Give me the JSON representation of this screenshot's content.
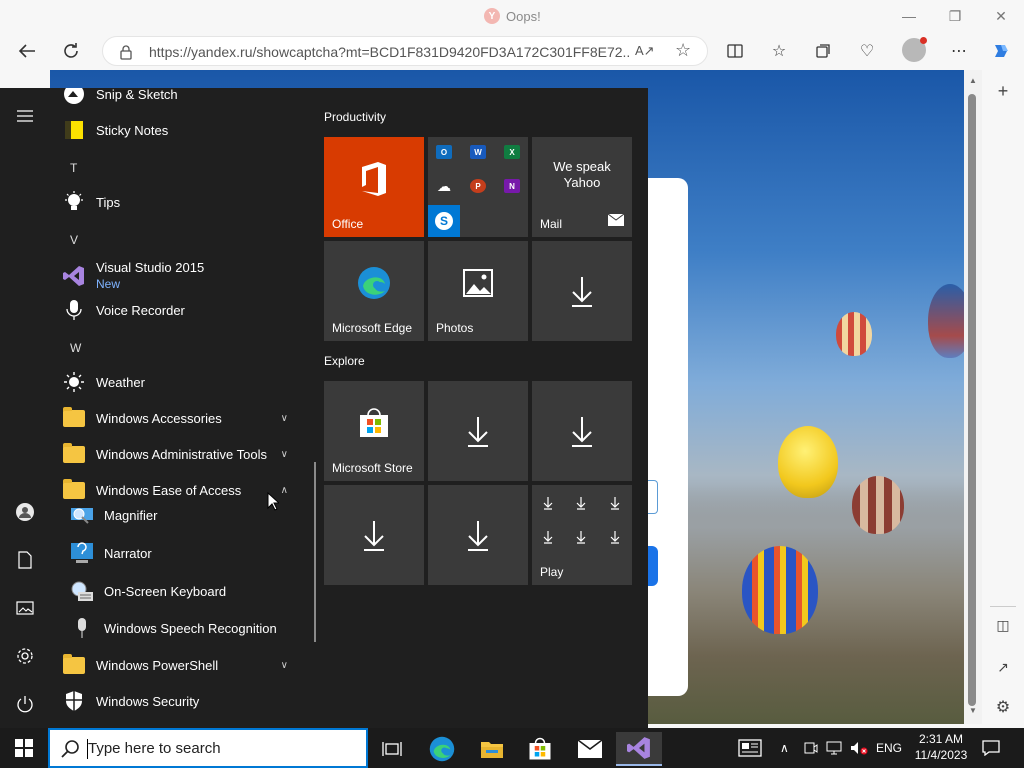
{
  "browser": {
    "tab_title": "Oops!",
    "tab_icon_letter": "Y",
    "url": "https://yandex.ru/showcaptcha?mt=BCD1F831D9420FD3A172C301FF8E72..."
  },
  "start_menu": {
    "apps": [
      {
        "label": "Snip & Sketch",
        "icon": "snip-sketch-icon"
      },
      {
        "label": "Sticky Notes",
        "icon": "sticky-notes-icon"
      },
      {
        "letter": "T"
      },
      {
        "label": "Tips",
        "icon": "lightbulb-icon"
      },
      {
        "letter": "V"
      },
      {
        "label": "Visual Studio 2015",
        "badge": "New",
        "icon": "visual-studio-icon"
      },
      {
        "label": "Voice Recorder",
        "icon": "microphone-icon"
      },
      {
        "letter": "W"
      },
      {
        "label": "Weather",
        "icon": "sun-icon"
      },
      {
        "label": "Windows Accessories",
        "icon": "folder-icon",
        "expandable": true
      },
      {
        "label": "Windows Administrative Tools",
        "icon": "folder-icon",
        "expandable": true
      },
      {
        "label": "Windows Ease of Access",
        "icon": "folder-icon",
        "expanded": true
      },
      {
        "label": "Magnifier",
        "icon": "magnifier-icon",
        "sub": true
      },
      {
        "label": "Narrator",
        "icon": "narrator-icon",
        "sub": true
      },
      {
        "label": "On-Screen Keyboard",
        "icon": "keyboard-icon",
        "sub": true
      },
      {
        "label": "Windows Speech Recognition",
        "icon": "microphone-icon",
        "sub": true
      },
      {
        "label": "Windows PowerShell",
        "icon": "folder-icon",
        "expandable": true
      },
      {
        "label": "Windows Security",
        "icon": "shield-icon"
      }
    ],
    "groups": [
      {
        "title": "Productivity"
      },
      {
        "title": "Explore"
      }
    ],
    "tiles": {
      "office": "Office",
      "mail_text_line1": "We speak",
      "mail_text_line2": "Yahoo",
      "mail": "Mail",
      "edge": "Microsoft Edge",
      "photos": "Photos",
      "store": "Microsoft Store",
      "play": "Play"
    }
  },
  "taskbar": {
    "search_placeholder": "Type here to search",
    "language": "ENG",
    "time": "2:31 AM",
    "date": "11/4/2023"
  },
  "colors": {
    "office_tile": "#d83b01",
    "start_bg": "#1f1f1f",
    "accent": "#0078d4"
  }
}
